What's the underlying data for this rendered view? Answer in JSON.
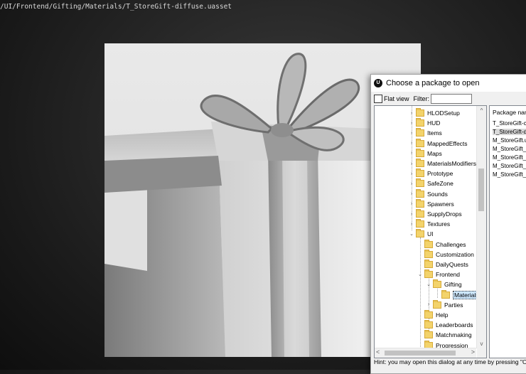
{
  "asset_path": "/UI/Frontend/Gifting/Materials/T_StoreGift-diffuse.uasset",
  "dialog": {
    "title": "Choose a package to open",
    "app_icon_glyph": "U",
    "flat_view_label": "Flat view",
    "filter_label": "Filter:",
    "filter_value": "",
    "hint": "Hint: you may open this dialog at any time by pressing \"O\""
  },
  "tree": {
    "items": [
      {
        "label": "HLODSetup",
        "expander": "›"
      },
      {
        "label": "HUD",
        "expander": "›"
      },
      {
        "label": "Items",
        "expander": "›"
      },
      {
        "label": "MappedEffects",
        "expander": "›"
      },
      {
        "label": "Maps",
        "expander": "›"
      },
      {
        "label": "MaterialsModifiers",
        "expander": "›"
      },
      {
        "label": "Prototype",
        "expander": "›"
      },
      {
        "label": "SafeZone",
        "expander": "›"
      },
      {
        "label": "Sounds",
        "expander": "›"
      },
      {
        "label": "Spawners",
        "expander": "›"
      },
      {
        "label": "SupplyDrops",
        "expander": "›"
      },
      {
        "label": "Textures",
        "expander": "›"
      },
      {
        "label": "UI",
        "expander": "⌄"
      },
      {
        "label": "Challenges",
        "expander": ""
      },
      {
        "label": "Customization",
        "expander": ""
      },
      {
        "label": "DailyQuests",
        "expander": ""
      },
      {
        "label": "Frontend",
        "expander": "⌄"
      },
      {
        "label": "Gifting",
        "expander": "⌄"
      },
      {
        "label": "Materials",
        "expander": ""
      },
      {
        "label": "Parties",
        "expander": "›"
      },
      {
        "label": "Help",
        "expander": ""
      },
      {
        "label": "Leaderboards",
        "expander": ""
      },
      {
        "label": "Matchmaking",
        "expander": ""
      },
      {
        "label": "Progression",
        "expander": ""
      }
    ],
    "selected": "Materials"
  },
  "packages": {
    "header": "Package name",
    "items": [
      "T_StoreGift-ch",
      "T_StoreGift-dif",
      "M_StoreGift.ua",
      "M_StoreGift_v",
      "M_StoreGift_v",
      "M_StoreGift_v",
      "M_StoreGift_v"
    ],
    "selected_index": 1
  },
  "colors": {
    "folder": "#f3d36b",
    "selection": "#cde8ff"
  }
}
